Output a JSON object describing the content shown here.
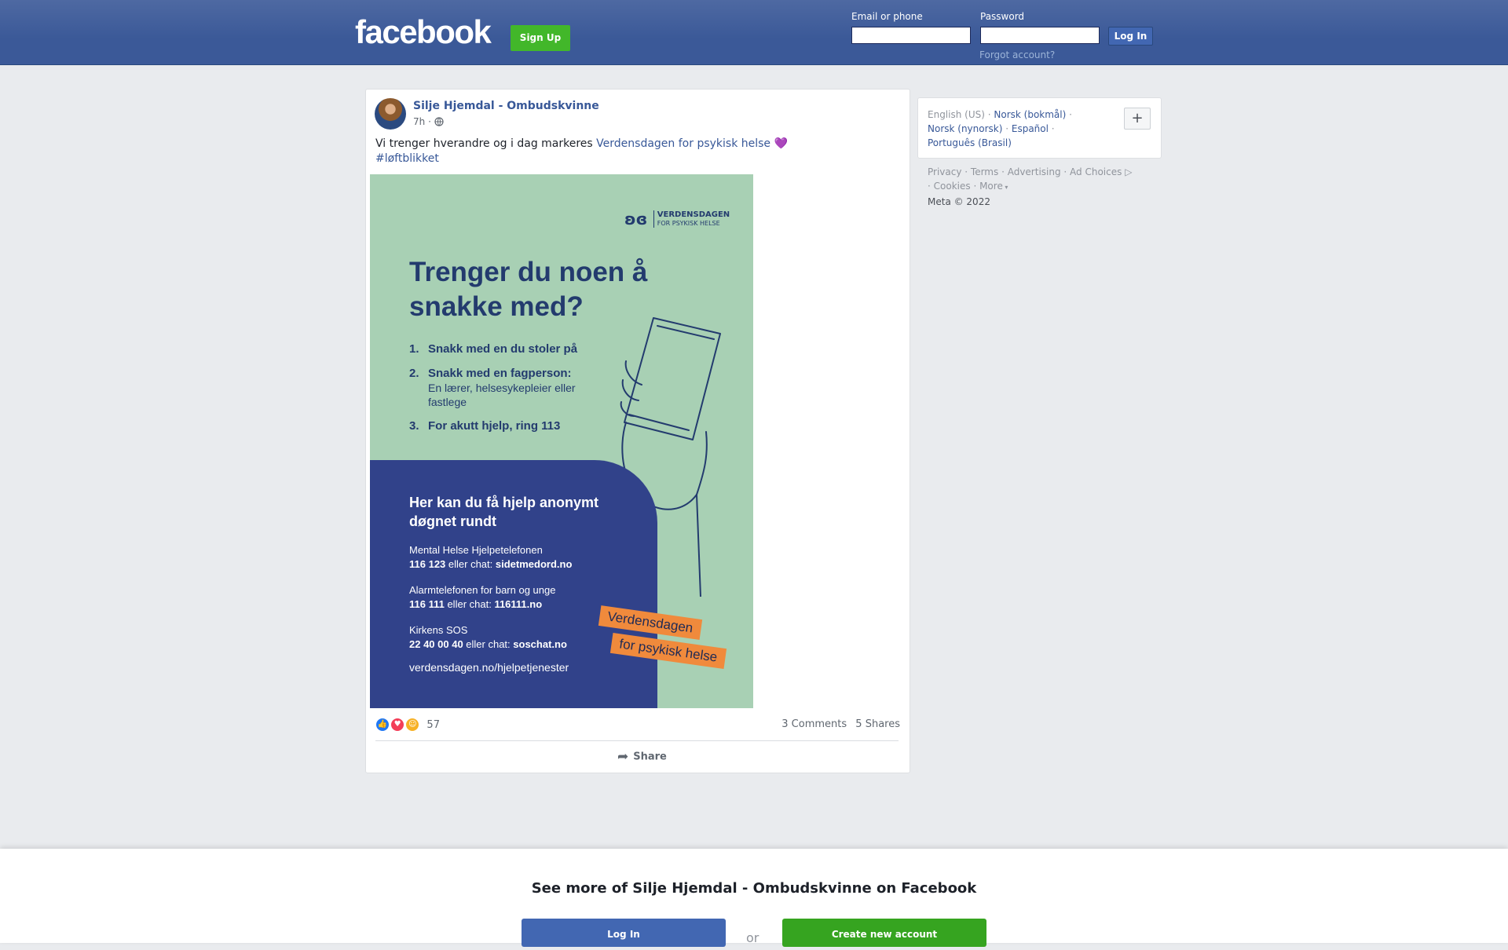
{
  "header": {
    "logo": "facebook",
    "signup_label": "Sign Up",
    "email_label": "Email or phone",
    "email_value": "",
    "password_label": "Password",
    "password_value": "",
    "login_label": "Log In",
    "forgot_label": "Forgot account?"
  },
  "post": {
    "author": "Silje Hjemdal - Ombudskvinne",
    "time": "7h",
    "privacy_icon": "globe-icon",
    "text_before": "Vi trenger hverandre og i dag markeres ",
    "text_link": "Verdensdagen for psykisk helse",
    "emoji": "💜",
    "hashtag": "#løftblikket",
    "image": {
      "brand_line1": "VERDENSDAGEN",
      "brand_line2": "FOR PSYKISK HELSE",
      "headline": "Trenger du noen å snakke med?",
      "steps": [
        {
          "num": "1.",
          "title": "Snakk med en du stoler på",
          "sub": ""
        },
        {
          "num": "2.",
          "title": "Snakk med en fagperson:",
          "sub": "En lærer, helsesykepleier eller fastlege"
        },
        {
          "num": "3.",
          "title": "For akutt hjelp, ring 113",
          "sub": ""
        }
      ],
      "help_title": "Her kan du få hjelp anonymt døgnet rundt",
      "help_items": [
        {
          "name": "Mental Helse Hjelpetelefonen",
          "number": "116 123",
          "mid": " eller chat: ",
          "chat": "sidetmedord.no"
        },
        {
          "name": "Alarmtelefonen for barn og unge",
          "number": "116 111",
          "mid": " eller chat: ",
          "chat": "116111.no"
        },
        {
          "name": "Kirkens SOS",
          "number": "22 40 00 40",
          "mid": " eller chat: ",
          "chat": "soschat.no"
        }
      ],
      "help_site": "verdensdagen.no/hjelpetjenester",
      "tag1": "Verdensdagen",
      "tag2": "for psykisk helse"
    },
    "reaction_icons": [
      "like-icon",
      "love-icon",
      "care-icon"
    ],
    "reaction_count": "57",
    "comments": "3 Comments",
    "shares": "5 Shares",
    "share_label": "Share"
  },
  "sidebar": {
    "languages": [
      "English (US)",
      "Norsk (bokmål)",
      "Norsk (nynorsk)",
      "Español",
      "Português (Brasil)"
    ],
    "add_language": "+",
    "footer": [
      "Privacy",
      "Terms",
      "Advertising",
      "Ad Choices",
      "Cookies",
      "More"
    ],
    "copyright": "Meta © 2022"
  },
  "bottom": {
    "title": "See more of Silje Hjemdal - Ombudskvinne on Facebook",
    "login_label": "Log In",
    "or_label": "or",
    "create_label": "Create new account"
  },
  "colors": {
    "brand": "#3b5998",
    "signup_green": "#42b72a",
    "poster_green": "#a8d0b4",
    "poster_blue": "#31428a",
    "poster_orange": "#f08a3c"
  }
}
